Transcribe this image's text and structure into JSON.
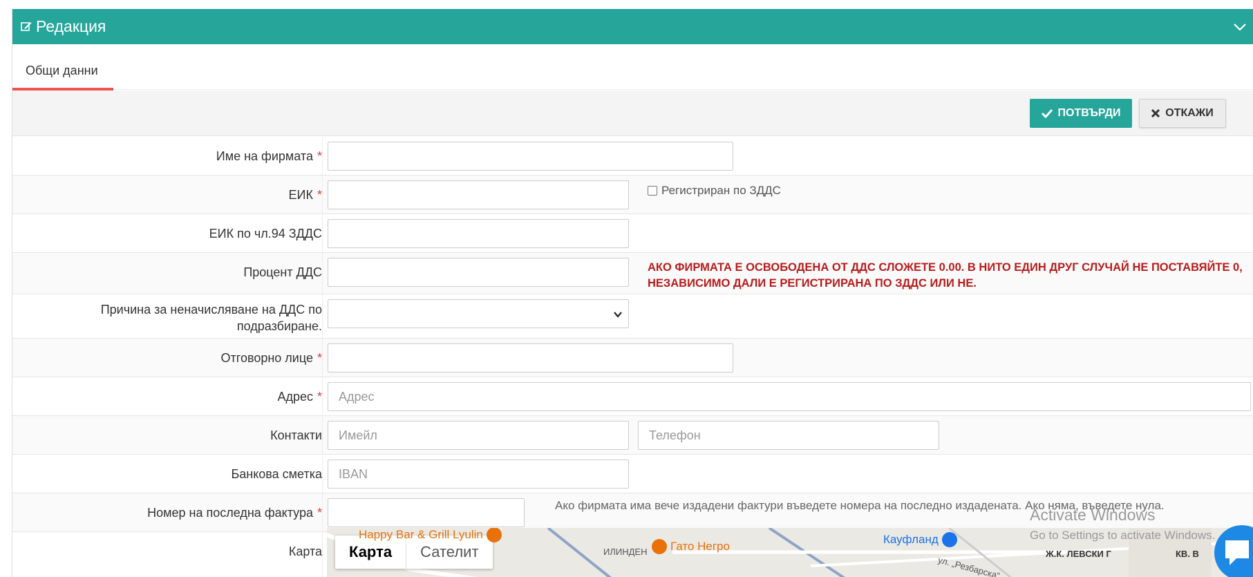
{
  "header": {
    "title": "Редакция",
    "icon": "edit-icon",
    "collapse_icon": "chevron-down-icon",
    "color": "#26a69a"
  },
  "tabs": [
    {
      "label": "Общи данни",
      "active": true
    }
  ],
  "actions": {
    "confirm_label": "ПОТВЪРДИ",
    "cancel_label": "ОТКАЖИ"
  },
  "form": {
    "company_name": {
      "label": "Име на фирмата",
      "required": "*",
      "value": ""
    },
    "eik": {
      "label": "ЕИК",
      "required": "*",
      "value": "",
      "vat_registered_label": "Регистриран по ЗДДС",
      "vat_registered_checked": false
    },
    "eik_94": {
      "label": "ЕИК по чл.94 ЗДДС",
      "value": ""
    },
    "vat_percent": {
      "label": "Процент ДДС",
      "value": "",
      "warning": "АКО ФИРМАТА Е ОСВОБОДЕНА ОТ ДДС СЛОЖЕТЕ 0.00. В НИТО ЕДИН ДРУГ СЛУЧАЙ НЕ ПОСТАВЯЙТЕ 0, НЕЗАВИСИМО ДАЛИ Е РЕГИСТРИРАНА ПО ЗДДС ИЛИ НЕ."
    },
    "no_vat_reason": {
      "label_line1": "Причина за неначисляване на ДДС по",
      "label_line2": "подразбиране.",
      "value": ""
    },
    "responsible": {
      "label": "Отговорно лице",
      "required": "*",
      "value": ""
    },
    "address": {
      "label": "Адрес",
      "required": "*",
      "placeholder": "Адрес"
    },
    "contacts": {
      "label": "Контакти",
      "email_placeholder": "Имейл",
      "phone_placeholder": "Телефон"
    },
    "bank": {
      "label": "Банкова сметка",
      "placeholder": "IBAN"
    },
    "last_invoice": {
      "label": "Номер на последна фактура",
      "required": "*",
      "value": "",
      "hint": "Ако фирмата има вече издадени фактури въведете номера на последно издадената. Ако няма, въведете нула."
    },
    "map": {
      "label": "Карта"
    }
  },
  "map": {
    "toggle_map": "Карта",
    "toggle_satellite": "Сателит",
    "pois": [
      {
        "name": "Happy Bar & Grill Lyulin",
        "color": "#e8710a"
      },
      {
        "name": "Гато Негро",
        "color": "#e8710a"
      },
      {
        "name": "Кауфланд",
        "color": "#1a73e8"
      }
    ],
    "labels": [
      "ИЛИНДЕН",
      "Ж.К. ЛЕВСКИ Г",
      "КВ. В",
      "ул. „Резбарска“"
    ]
  },
  "watermark": {
    "line1": "Activate Windows",
    "line2": "Go to Settings to activate Windows."
  }
}
